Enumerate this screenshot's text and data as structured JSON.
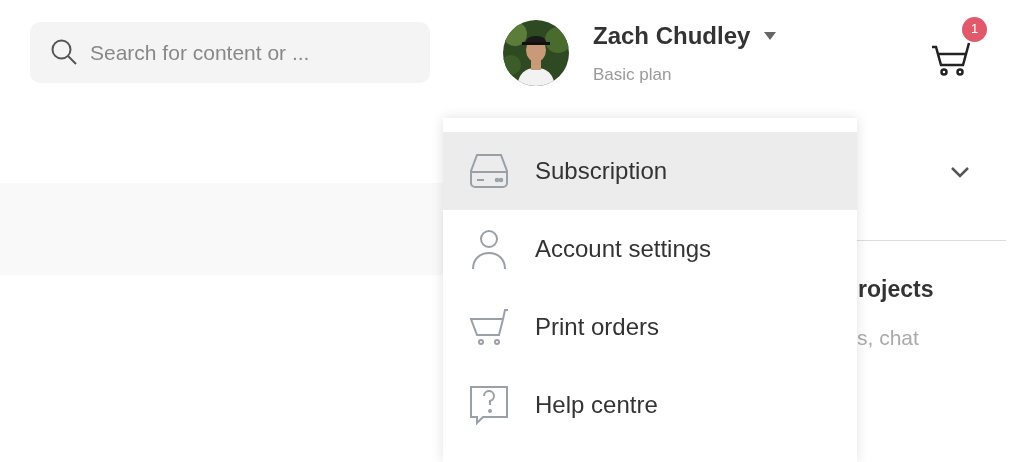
{
  "search": {
    "placeholder": "Search for content or ..."
  },
  "account": {
    "name": "Zach Chudley",
    "plan": "Basic plan"
  },
  "cart": {
    "badge": "1"
  },
  "background_panel": {
    "heading": "rojects",
    "subtext": "s, chat"
  },
  "menu": {
    "items": [
      {
        "kind": "subscription",
        "label": "Subscription",
        "selected": true
      },
      {
        "kind": "account",
        "label": "Account settings",
        "selected": false
      },
      {
        "kind": "orders",
        "label": "Print orders",
        "selected": false
      },
      {
        "kind": "help",
        "label": "Help centre",
        "selected": false
      }
    ]
  }
}
